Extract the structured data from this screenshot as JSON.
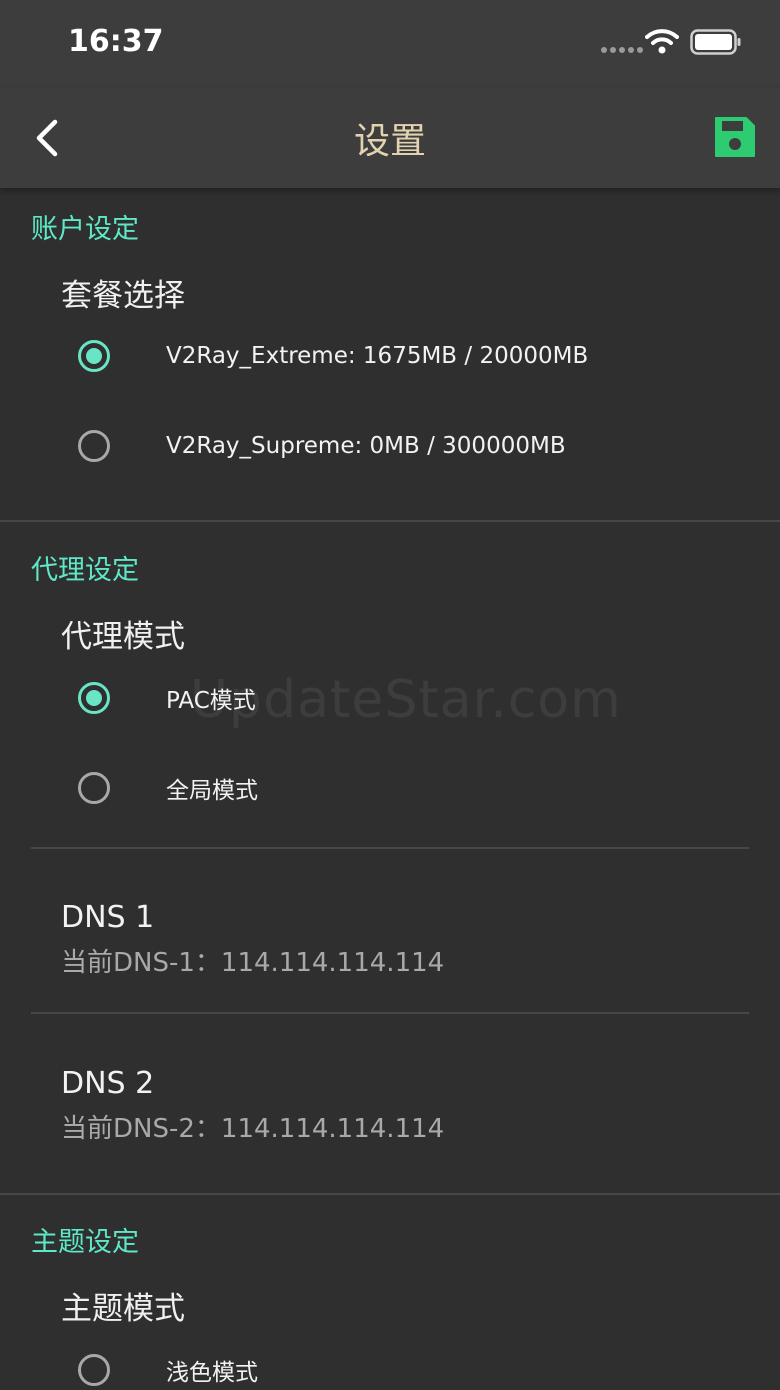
{
  "status_bar": {
    "time": "16:37"
  },
  "nav": {
    "title": "设置"
  },
  "account": {
    "section_title": "账户设定",
    "group_label": "套餐选择",
    "options": [
      {
        "label": "V2Ray_Extreme:  1675MB / 20000MB",
        "selected": true
      },
      {
        "label": "V2Ray_Supreme:  0MB / 300000MB",
        "selected": false
      }
    ]
  },
  "proxy": {
    "section_title": "代理设定",
    "group_label": "代理模式",
    "options": [
      {
        "label": "PAC模式",
        "selected": true
      },
      {
        "label": "全局模式",
        "selected": false
      }
    ],
    "dns1": {
      "title": "DNS 1",
      "value": "当前DNS-1：114.114.114.114"
    },
    "dns2": {
      "title": "DNS 2",
      "value": "当前DNS-2：114.114.114.114"
    }
  },
  "theme": {
    "section_title": "主题设定",
    "group_label": "主题模式",
    "options": [
      {
        "label": "浅色模式",
        "selected": false
      }
    ]
  },
  "watermark": "UpdateStar.com",
  "colors": {
    "accent": "#69e4c4",
    "save": "#2ecc71",
    "title": "#e3d2b0",
    "background": "#2f2f2f"
  }
}
